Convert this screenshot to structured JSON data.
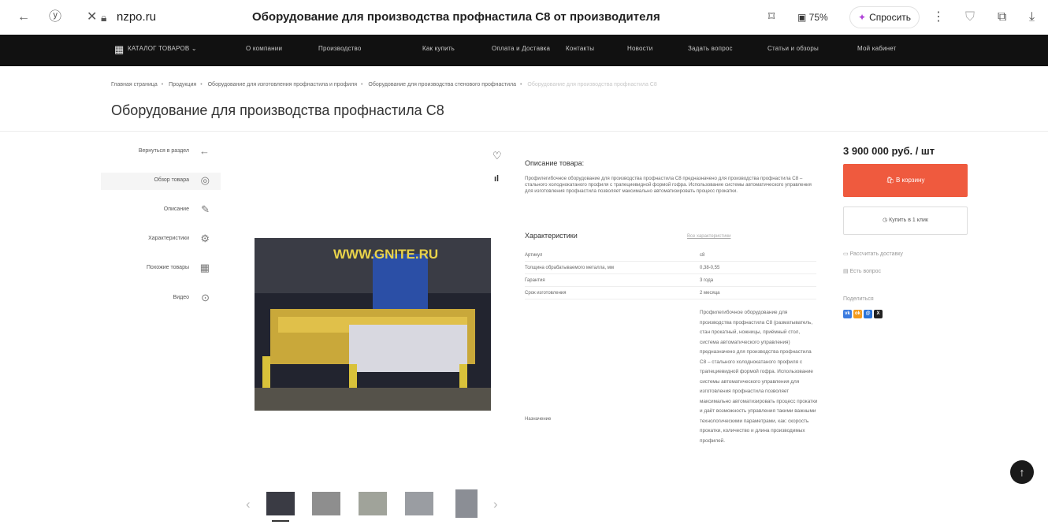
{
  "browser": {
    "url": "nzpo.ru",
    "title": "Оборудование для производства профнастила С8 от производителя",
    "zoom": "75%",
    "ask_label": "Спросить"
  },
  "nav": {
    "catalog": "КАТАЛОГ ТОВАРОВ",
    "items": [
      "О компании",
      "Производство",
      "Как купить",
      "Оплата и Доставка",
      "Контакты",
      "Новости",
      "Задать вопрос",
      "Статьи и обзоры",
      "Мой кабинет"
    ]
  },
  "breadcrumb": [
    "Главная страница",
    "Продукция",
    "Оборудование для изготовления профнастила и профиля",
    "Оборудование для производства стенового профнастила",
    "Оборудование для производства профнастила С8"
  ],
  "page": {
    "title": "Оборудование для производства профнастила С8"
  },
  "sidemenu": [
    {
      "label": "Вернуться в раздел",
      "icon": "arrow-left-icon"
    },
    {
      "label": "Обзор товара",
      "icon": "eye-icon"
    },
    {
      "label": "Описание",
      "icon": "pencil-icon"
    },
    {
      "label": "Характеристики",
      "icon": "gear-icon"
    },
    {
      "label": "Похожие товары",
      "icon": "grid-icon"
    },
    {
      "label": "Видео",
      "icon": "play-icon"
    }
  ],
  "product_image": {
    "watermark": "WWW.GNITE.RU"
  },
  "description": {
    "title": "Описание товара:",
    "text": "Профилегибочное оборудование для производства профнастила С8 предназначено для производства профнастила С8 – стального холоднокатаного профиля с трапециевидной формой гофра. Использование системы автоматического управления для изготовления профнастила позволяет максимально автоматизировать процесс прокатки."
  },
  "characteristics": {
    "title": "Характеристики",
    "all_link": "Все характеристики",
    "rows": [
      {
        "key": "Артикул",
        "value": "c8"
      },
      {
        "key": "Толщина обрабатываемого металла, мм",
        "value": "0,38-0,55"
      },
      {
        "key": "Гарантия",
        "value": "3 года"
      },
      {
        "key": "Срок изготовления",
        "value": "2 месяца"
      }
    ],
    "purpose_key": "Назначение",
    "purpose_value": "Профилегибочное оборудование для производства профнастила С8 (разматыватель, стан прокатный, ножницы, приёмный стол, система автоматического управления) предназначено для производства профнастила С8 – стального холоднокатаного профиля с трапециевидной формой гофра. Использование системы автоматического управления для изготовления профнастила позволяет максимально автоматизировать процесс прокатки и даёт возможность управления такими важными технологическими параметрами, как: скорость прокатки, количество и длина производимых профилей."
  },
  "buy": {
    "price": "3 900 000 руб. / шт",
    "cart": "В корзину",
    "one_click": "Купить в 1 клик",
    "delivery": "Рассчитать доставку",
    "question": "Есть вопрос",
    "share_label": "Поделиться"
  },
  "colors": {
    "accent": "#ef5a3e",
    "nav_bg": "#111111"
  }
}
